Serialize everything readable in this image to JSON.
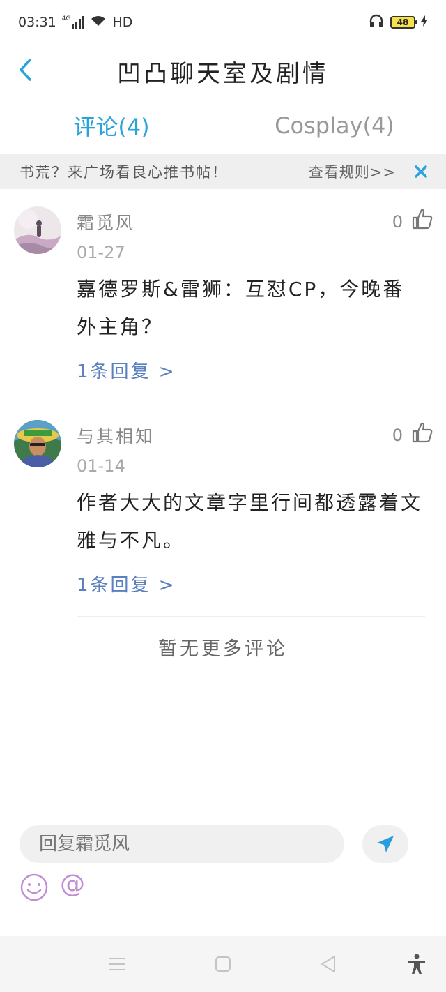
{
  "status_bar": {
    "time": "03:31",
    "network": "4G",
    "hd": "HD",
    "battery": "48"
  },
  "header": {
    "title": "凹凸聊天室及剧情"
  },
  "tabs": [
    {
      "label": "评论(4)",
      "active": true
    },
    {
      "label": "Cosplay(4)",
      "active": false
    }
  ],
  "notice": {
    "text": "书荒？来广场看良心推书帖！",
    "rules_link": "查看规则>>"
  },
  "comments": [
    {
      "user": "霜觅风",
      "date": "01-27",
      "likes": "0",
      "text": "嘉德罗斯&雷狮：互怼CP，今晚番外主角？",
      "replies": "1条回复 >"
    },
    {
      "user": "与其相知",
      "date": "01-14",
      "likes": "0",
      "text": "作者大大的文章字里行间都透露着文雅与不凡。",
      "replies": "1条回复 >"
    }
  ],
  "footer": {
    "no_more": "暂无更多评论"
  },
  "input": {
    "placeholder": "回复霜觅风"
  },
  "colors": {
    "accent": "#2aa3dc",
    "reply_link": "#5a7fbf",
    "send_icon": "#2a9ce0",
    "emoji": "#c18ed6"
  }
}
